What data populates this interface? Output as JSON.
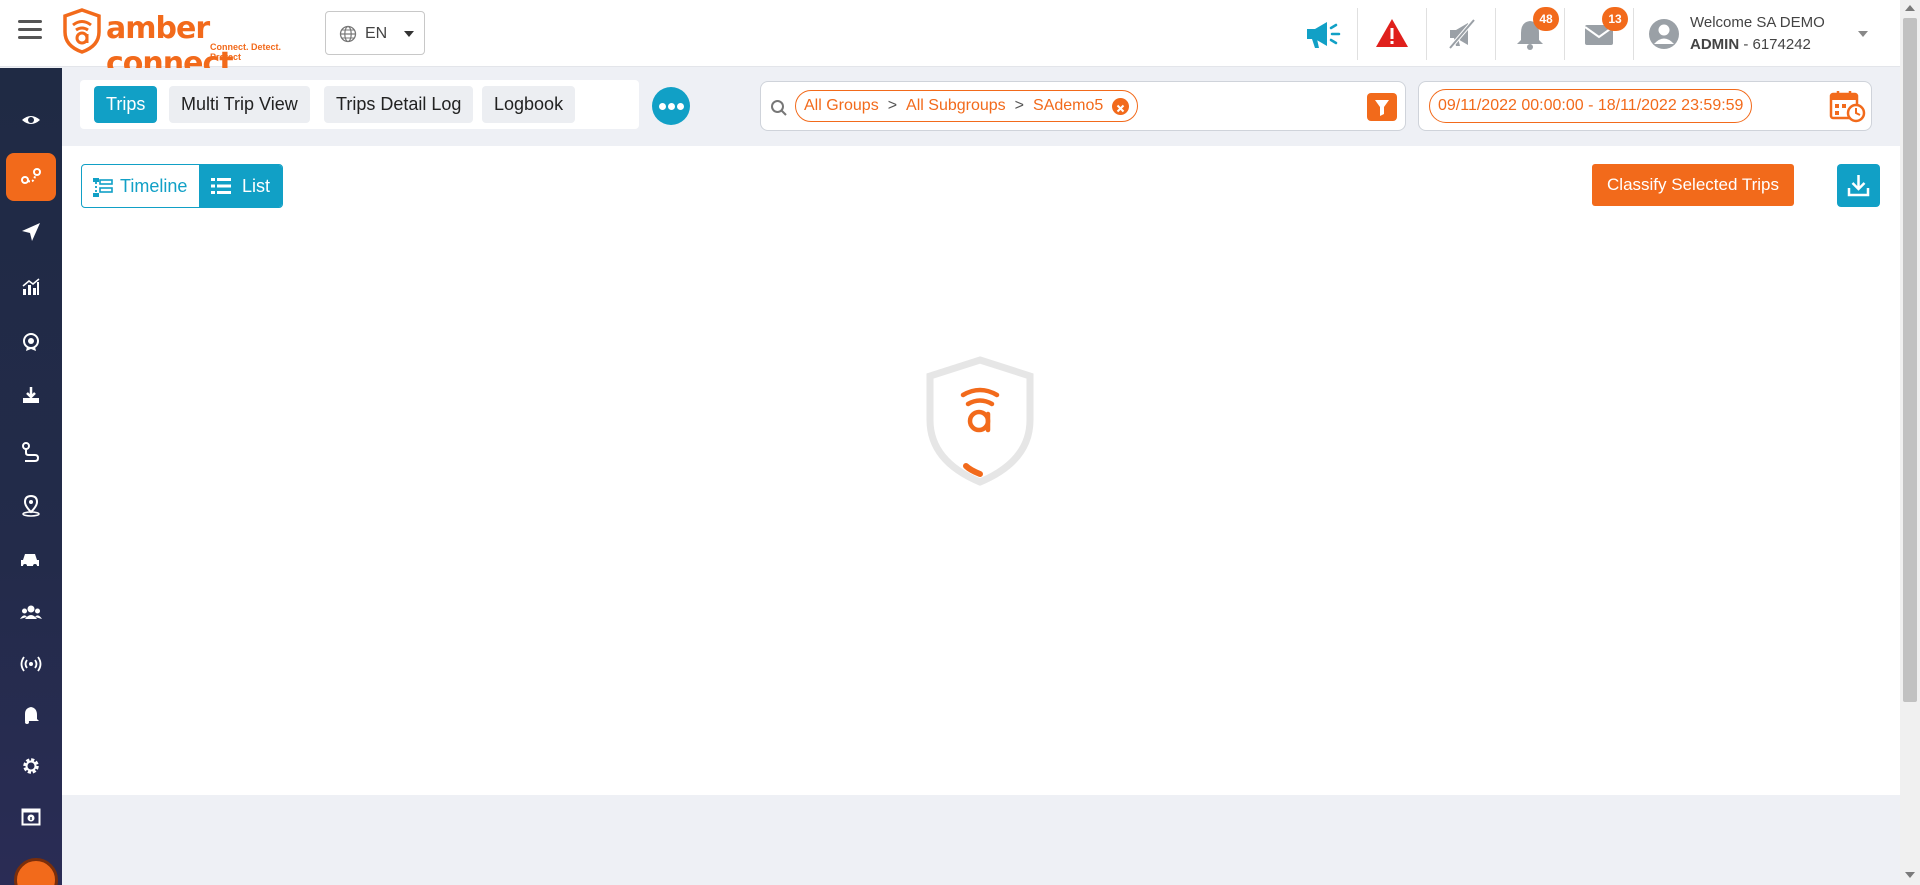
{
  "header": {
    "logo": {
      "word": "amber connect",
      "tagline": "Connect. Detect. Protect",
      "icon": "amber-shield-logo"
    },
    "language": {
      "selected": "EN",
      "icon": "globe-icon"
    },
    "icons": [
      {
        "name": "megaphone-icon",
        "color": "#11a0c6"
      },
      {
        "name": "alert-triangle-icon",
        "color": "#e0201c"
      },
      {
        "name": "muted-megaphone-icon",
        "color": "#9aa0a6"
      },
      {
        "name": "bell-icon",
        "badge": "48"
      },
      {
        "name": "mail-icon",
        "badge": "13"
      }
    ],
    "user": {
      "welcome": "Welcome SA DEMO",
      "role": "ADMIN",
      "id": " - 6174242",
      "icon": "user-avatar-icon"
    }
  },
  "sidebar": {
    "items": [
      {
        "name": "sidebar-item-live-view",
        "icon": "eye-icon"
      },
      {
        "name": "sidebar-item-trips",
        "icon": "route-icon",
        "active": true
      },
      {
        "name": "sidebar-item-navigation",
        "icon": "send-icon"
      },
      {
        "name": "sidebar-item-analytics",
        "icon": "chart-icon"
      },
      {
        "name": "sidebar-item-driver-score",
        "icon": "award-icon"
      },
      {
        "name": "sidebar-item-downloads",
        "icon": "download-tray-icon"
      },
      {
        "name": "sidebar-item-routes",
        "icon": "routes-icon"
      },
      {
        "name": "sidebar-item-geofence",
        "icon": "location-pin-icon"
      },
      {
        "name": "sidebar-item-vehicles",
        "icon": "car-icon"
      },
      {
        "name": "sidebar-item-users",
        "icon": "users-icon"
      },
      {
        "name": "sidebar-item-devices",
        "icon": "signal-icon"
      },
      {
        "name": "sidebar-item-notifications",
        "icon": "bell-side-icon"
      },
      {
        "name": "sidebar-item-settings",
        "icon": "gear-icon"
      },
      {
        "name": "sidebar-item-info",
        "icon": "info-panel-icon"
      }
    ]
  },
  "tabs": [
    {
      "label": "Trips",
      "active": true
    },
    {
      "label": "Multi Trip View"
    },
    {
      "label": "Trips Detail Log"
    },
    {
      "label": "Logbook"
    }
  ],
  "filter": {
    "group": "All Groups",
    "subgroup": "All Subgroups",
    "separator": ">",
    "vehicle": "SAdemo5"
  },
  "date_range": "09/11/2022 00:00:00 - 18/11/2022 23:59:59",
  "view_toggle": {
    "timeline": "Timeline",
    "list": "List",
    "selected": "List"
  },
  "actions": {
    "classify": "Classify Selected Trips",
    "download_icon": "download-icon"
  },
  "loader": {
    "icon": "amber-shield-loader-icon"
  },
  "colors": {
    "brand": "#f26a1b",
    "accent": "#11a0c6",
    "sidebar": "#1f2a44"
  }
}
